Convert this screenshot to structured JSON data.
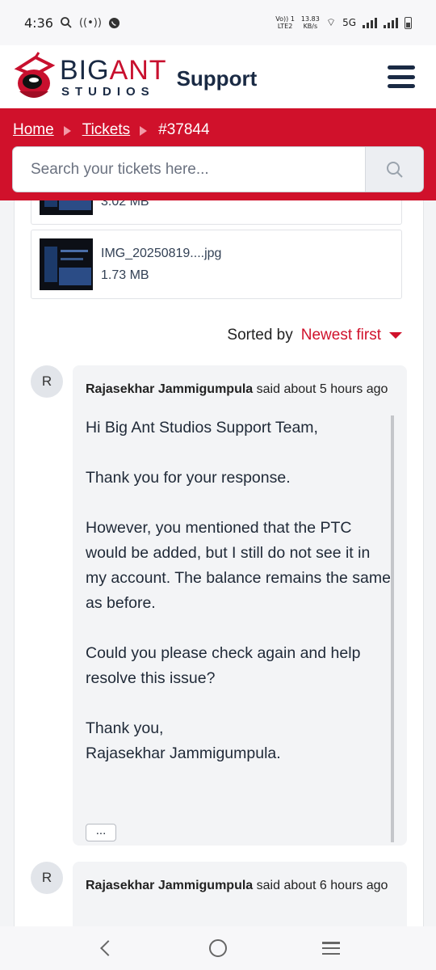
{
  "status_bar": {
    "time": "4:36",
    "network_top": "Vo)) 1",
    "network_bottom": "LTE2",
    "speed_value": "13.83",
    "speed_unit": "KB/s",
    "network_type": "5G"
  },
  "header": {
    "logo_big": "BIG",
    "logo_ant": "ANT",
    "logo_studios": "STUDIOS",
    "title": "Support",
    "brand_color": "#d0112b",
    "navy_color": "#1a2a44"
  },
  "breadcrumb": {
    "home": "Home",
    "tickets": "Tickets",
    "ticket_id": "#37844"
  },
  "search": {
    "placeholder": "Search your tickets here..."
  },
  "attachments": [
    {
      "size": "3.02 MB"
    },
    {
      "name": "IMG_20250819....jpg",
      "size": "1.73 MB"
    }
  ],
  "sort": {
    "label": "Sorted by",
    "value": "Newest first"
  },
  "comments": [
    {
      "avatar": "R",
      "author": "Rajasekhar Jammigumpula",
      "meta": " said about 5 hours ago",
      "body": [
        "Hi Big Ant Studios Support Team,",
        "Thank you for your response.",
        "However, you mentioned that the PTC would be added, but I still do not see it in my account. The balance remains the same as before.",
        "Could you please check again and help resolve this issue?",
        "Thank you,",
        "Rajasekhar Jammigumpula."
      ],
      "more": "..."
    },
    {
      "avatar": "R",
      "author": "Rajasekhar Jammigumpula",
      "meta": " said about 6 hours ago"
    }
  ]
}
